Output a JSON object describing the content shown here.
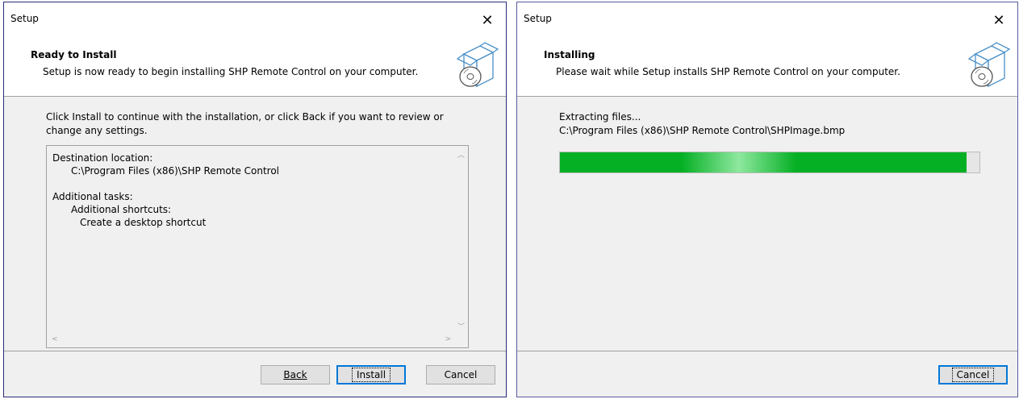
{
  "win1": {
    "title": "Setup",
    "header_title": "Ready to Install",
    "header_subtitle": "Setup is now ready to begin installing SHP Remote Control on your computer.",
    "intro_line1": "Click Install to continue with the installation, or click Back if you want to review or",
    "intro_line2": "change any settings.",
    "memo": {
      "dest_label": "Destination location:",
      "dest_value": "C:\\Program Files (x86)\\SHP Remote Control",
      "tasks_label": "Additional tasks:",
      "shortcuts_label": "Additional shortcuts:",
      "shortcut_item": "Create a desktop shortcut"
    },
    "buttons": {
      "back": "Back",
      "install": "Install",
      "cancel": "Cancel"
    }
  },
  "win2": {
    "title": "Setup",
    "header_title": "Installing",
    "header_subtitle": "Please wait while Setup installs SHP Remote Control on your computer.",
    "status": "Extracting files...",
    "file": "C:\\Program Files (x86)\\SHP Remote Control\\SHPImage.bmp",
    "progress": 0.97,
    "buttons": {
      "cancel": "Cancel"
    }
  },
  "colors": {
    "progress_fill": "#06b025",
    "accent": "#0078d7"
  },
  "icons": {
    "close": "close-icon",
    "installer": "installer-box-icon"
  }
}
